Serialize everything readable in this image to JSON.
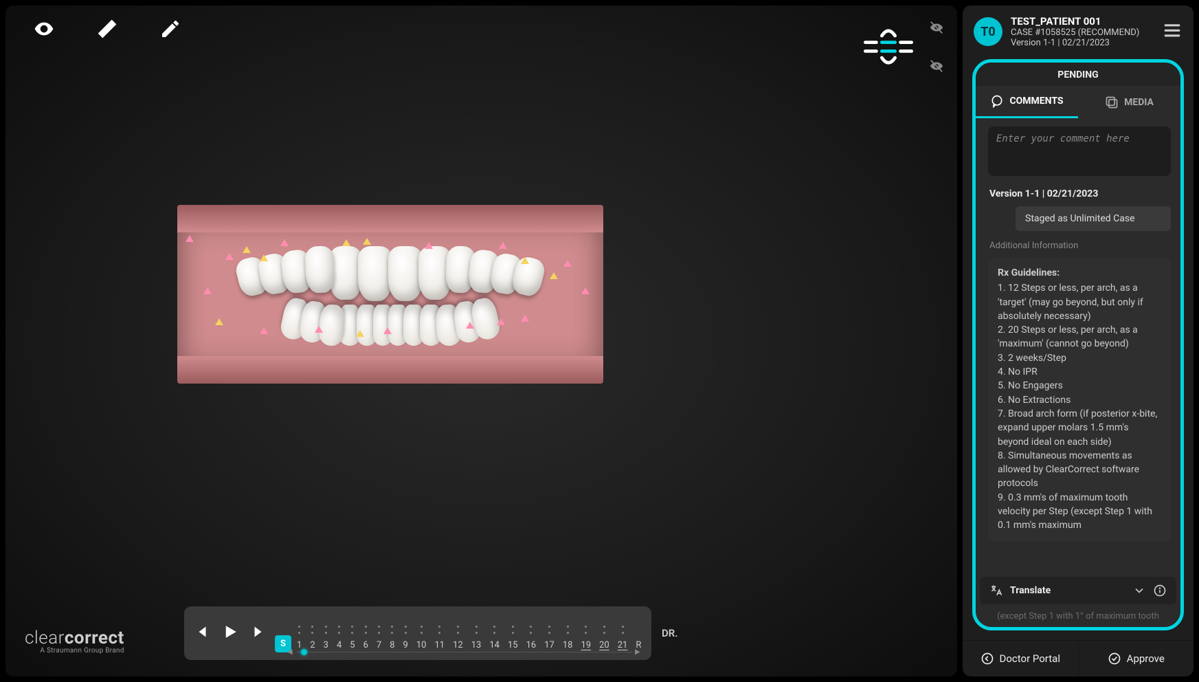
{
  "brand": {
    "name_prefix": "clear",
    "name_bold": "correct",
    "subtitle": "A Straumann Group Brand"
  },
  "header": {
    "avatar": "T0",
    "patient": "TEST_PATIENT 001",
    "case_line": "CASE #1058525 (RECOMMEND)",
    "version_line": "Version 1-1 | 02/21/2023"
  },
  "panel": {
    "status": "PENDING",
    "tabs": {
      "comments": "COMMENTS",
      "media": "MEDIA"
    },
    "comment_placeholder": "Enter your comment here",
    "version_row": "Version 1-1 | 02/21/2023",
    "staged_pill": "Staged as Unlimited Case",
    "additional_label": "Additional Information",
    "guidelines_title": "Rx Guidelines:",
    "guidelines": [
      "1. 12 Steps or less, per arch, as a 'target' (may go beyond, but only if absolutely necessary)",
      "2. 20 Steps or less, per arch, as a 'maximum' (cannot go beyond)",
      "3. 2 weeks/Step",
      "4. No IPR",
      "5. No Engagers",
      "6. No Extractions",
      "7. Broad arch form (if posterior x-bite, expand upper molars 1.5 mm's beyond ideal on each side)",
      "8. Simultaneous movements as allowed by ClearCorrect software protocols",
      "9. 0.3 mm's of maximum tooth velocity per Step (except Step 1 with 0.1 mm's maximum"
    ],
    "translate": "Translate",
    "truncated_hint": "(except Step 1 with 1° of maximum tooth"
  },
  "footer": {
    "doctor_portal": "Doctor Portal",
    "approve": "Approve"
  },
  "timeline": {
    "steps": [
      "S",
      "1",
      "2",
      "3",
      "4",
      "5",
      "6",
      "7",
      "8",
      "9",
      "10",
      "11",
      "12",
      "13",
      "14",
      "15",
      "16",
      "17",
      "18",
      "19",
      "20",
      "21",
      "R"
    ],
    "active": "S",
    "underlined": [
      "19",
      "20",
      "21"
    ]
  },
  "dr_label": "DR."
}
